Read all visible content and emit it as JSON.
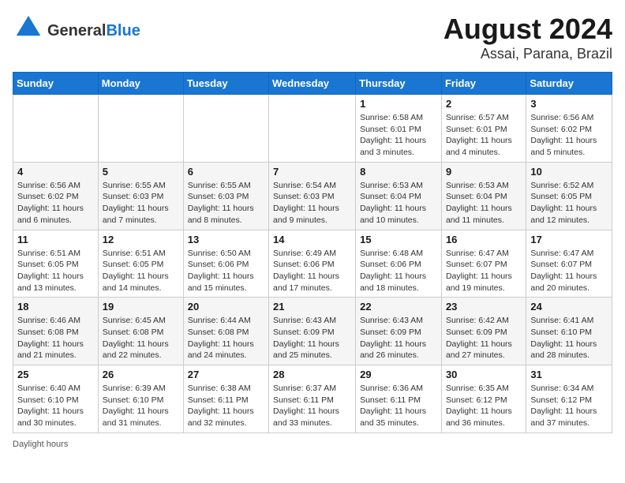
{
  "header": {
    "logo_general": "General",
    "logo_blue": "Blue",
    "title": "August 2024",
    "subtitle": "Assai, Parana, Brazil"
  },
  "weekdays": [
    "Sunday",
    "Monday",
    "Tuesday",
    "Wednesday",
    "Thursday",
    "Friday",
    "Saturday"
  ],
  "weeks": [
    [
      {
        "day": "",
        "detail": ""
      },
      {
        "day": "",
        "detail": ""
      },
      {
        "day": "",
        "detail": ""
      },
      {
        "day": "",
        "detail": ""
      },
      {
        "day": "1",
        "detail": "Sunrise: 6:58 AM\nSunset: 6:01 PM\nDaylight: 11 hours and 3 minutes."
      },
      {
        "day": "2",
        "detail": "Sunrise: 6:57 AM\nSunset: 6:01 PM\nDaylight: 11 hours and 4 minutes."
      },
      {
        "day": "3",
        "detail": "Sunrise: 6:56 AM\nSunset: 6:02 PM\nDaylight: 11 hours and 5 minutes."
      }
    ],
    [
      {
        "day": "4",
        "detail": "Sunrise: 6:56 AM\nSunset: 6:02 PM\nDaylight: 11 hours and 6 minutes."
      },
      {
        "day": "5",
        "detail": "Sunrise: 6:55 AM\nSunset: 6:03 PM\nDaylight: 11 hours and 7 minutes."
      },
      {
        "day": "6",
        "detail": "Sunrise: 6:55 AM\nSunset: 6:03 PM\nDaylight: 11 hours and 8 minutes."
      },
      {
        "day": "7",
        "detail": "Sunrise: 6:54 AM\nSunset: 6:03 PM\nDaylight: 11 hours and 9 minutes."
      },
      {
        "day": "8",
        "detail": "Sunrise: 6:53 AM\nSunset: 6:04 PM\nDaylight: 11 hours and 10 minutes."
      },
      {
        "day": "9",
        "detail": "Sunrise: 6:53 AM\nSunset: 6:04 PM\nDaylight: 11 hours and 11 minutes."
      },
      {
        "day": "10",
        "detail": "Sunrise: 6:52 AM\nSunset: 6:05 PM\nDaylight: 11 hours and 12 minutes."
      }
    ],
    [
      {
        "day": "11",
        "detail": "Sunrise: 6:51 AM\nSunset: 6:05 PM\nDaylight: 11 hours and 13 minutes."
      },
      {
        "day": "12",
        "detail": "Sunrise: 6:51 AM\nSunset: 6:05 PM\nDaylight: 11 hours and 14 minutes."
      },
      {
        "day": "13",
        "detail": "Sunrise: 6:50 AM\nSunset: 6:06 PM\nDaylight: 11 hours and 15 minutes."
      },
      {
        "day": "14",
        "detail": "Sunrise: 6:49 AM\nSunset: 6:06 PM\nDaylight: 11 hours and 17 minutes."
      },
      {
        "day": "15",
        "detail": "Sunrise: 6:48 AM\nSunset: 6:06 PM\nDaylight: 11 hours and 18 minutes."
      },
      {
        "day": "16",
        "detail": "Sunrise: 6:47 AM\nSunset: 6:07 PM\nDaylight: 11 hours and 19 minutes."
      },
      {
        "day": "17",
        "detail": "Sunrise: 6:47 AM\nSunset: 6:07 PM\nDaylight: 11 hours and 20 minutes."
      }
    ],
    [
      {
        "day": "18",
        "detail": "Sunrise: 6:46 AM\nSunset: 6:08 PM\nDaylight: 11 hours and 21 minutes."
      },
      {
        "day": "19",
        "detail": "Sunrise: 6:45 AM\nSunset: 6:08 PM\nDaylight: 11 hours and 22 minutes."
      },
      {
        "day": "20",
        "detail": "Sunrise: 6:44 AM\nSunset: 6:08 PM\nDaylight: 11 hours and 24 minutes."
      },
      {
        "day": "21",
        "detail": "Sunrise: 6:43 AM\nSunset: 6:09 PM\nDaylight: 11 hours and 25 minutes."
      },
      {
        "day": "22",
        "detail": "Sunrise: 6:43 AM\nSunset: 6:09 PM\nDaylight: 11 hours and 26 minutes."
      },
      {
        "day": "23",
        "detail": "Sunrise: 6:42 AM\nSunset: 6:09 PM\nDaylight: 11 hours and 27 minutes."
      },
      {
        "day": "24",
        "detail": "Sunrise: 6:41 AM\nSunset: 6:10 PM\nDaylight: 11 hours and 28 minutes."
      }
    ],
    [
      {
        "day": "25",
        "detail": "Sunrise: 6:40 AM\nSunset: 6:10 PM\nDaylight: 11 hours and 30 minutes."
      },
      {
        "day": "26",
        "detail": "Sunrise: 6:39 AM\nSunset: 6:10 PM\nDaylight: 11 hours and 31 minutes."
      },
      {
        "day": "27",
        "detail": "Sunrise: 6:38 AM\nSunset: 6:11 PM\nDaylight: 11 hours and 32 minutes."
      },
      {
        "day": "28",
        "detail": "Sunrise: 6:37 AM\nSunset: 6:11 PM\nDaylight: 11 hours and 33 minutes."
      },
      {
        "day": "29",
        "detail": "Sunrise: 6:36 AM\nSunset: 6:11 PM\nDaylight: 11 hours and 35 minutes."
      },
      {
        "day": "30",
        "detail": "Sunrise: 6:35 AM\nSunset: 6:12 PM\nDaylight: 11 hours and 36 minutes."
      },
      {
        "day": "31",
        "detail": "Sunrise: 6:34 AM\nSunset: 6:12 PM\nDaylight: 11 hours and 37 minutes."
      }
    ]
  ],
  "footer": {
    "daylight_label": "Daylight hours"
  }
}
